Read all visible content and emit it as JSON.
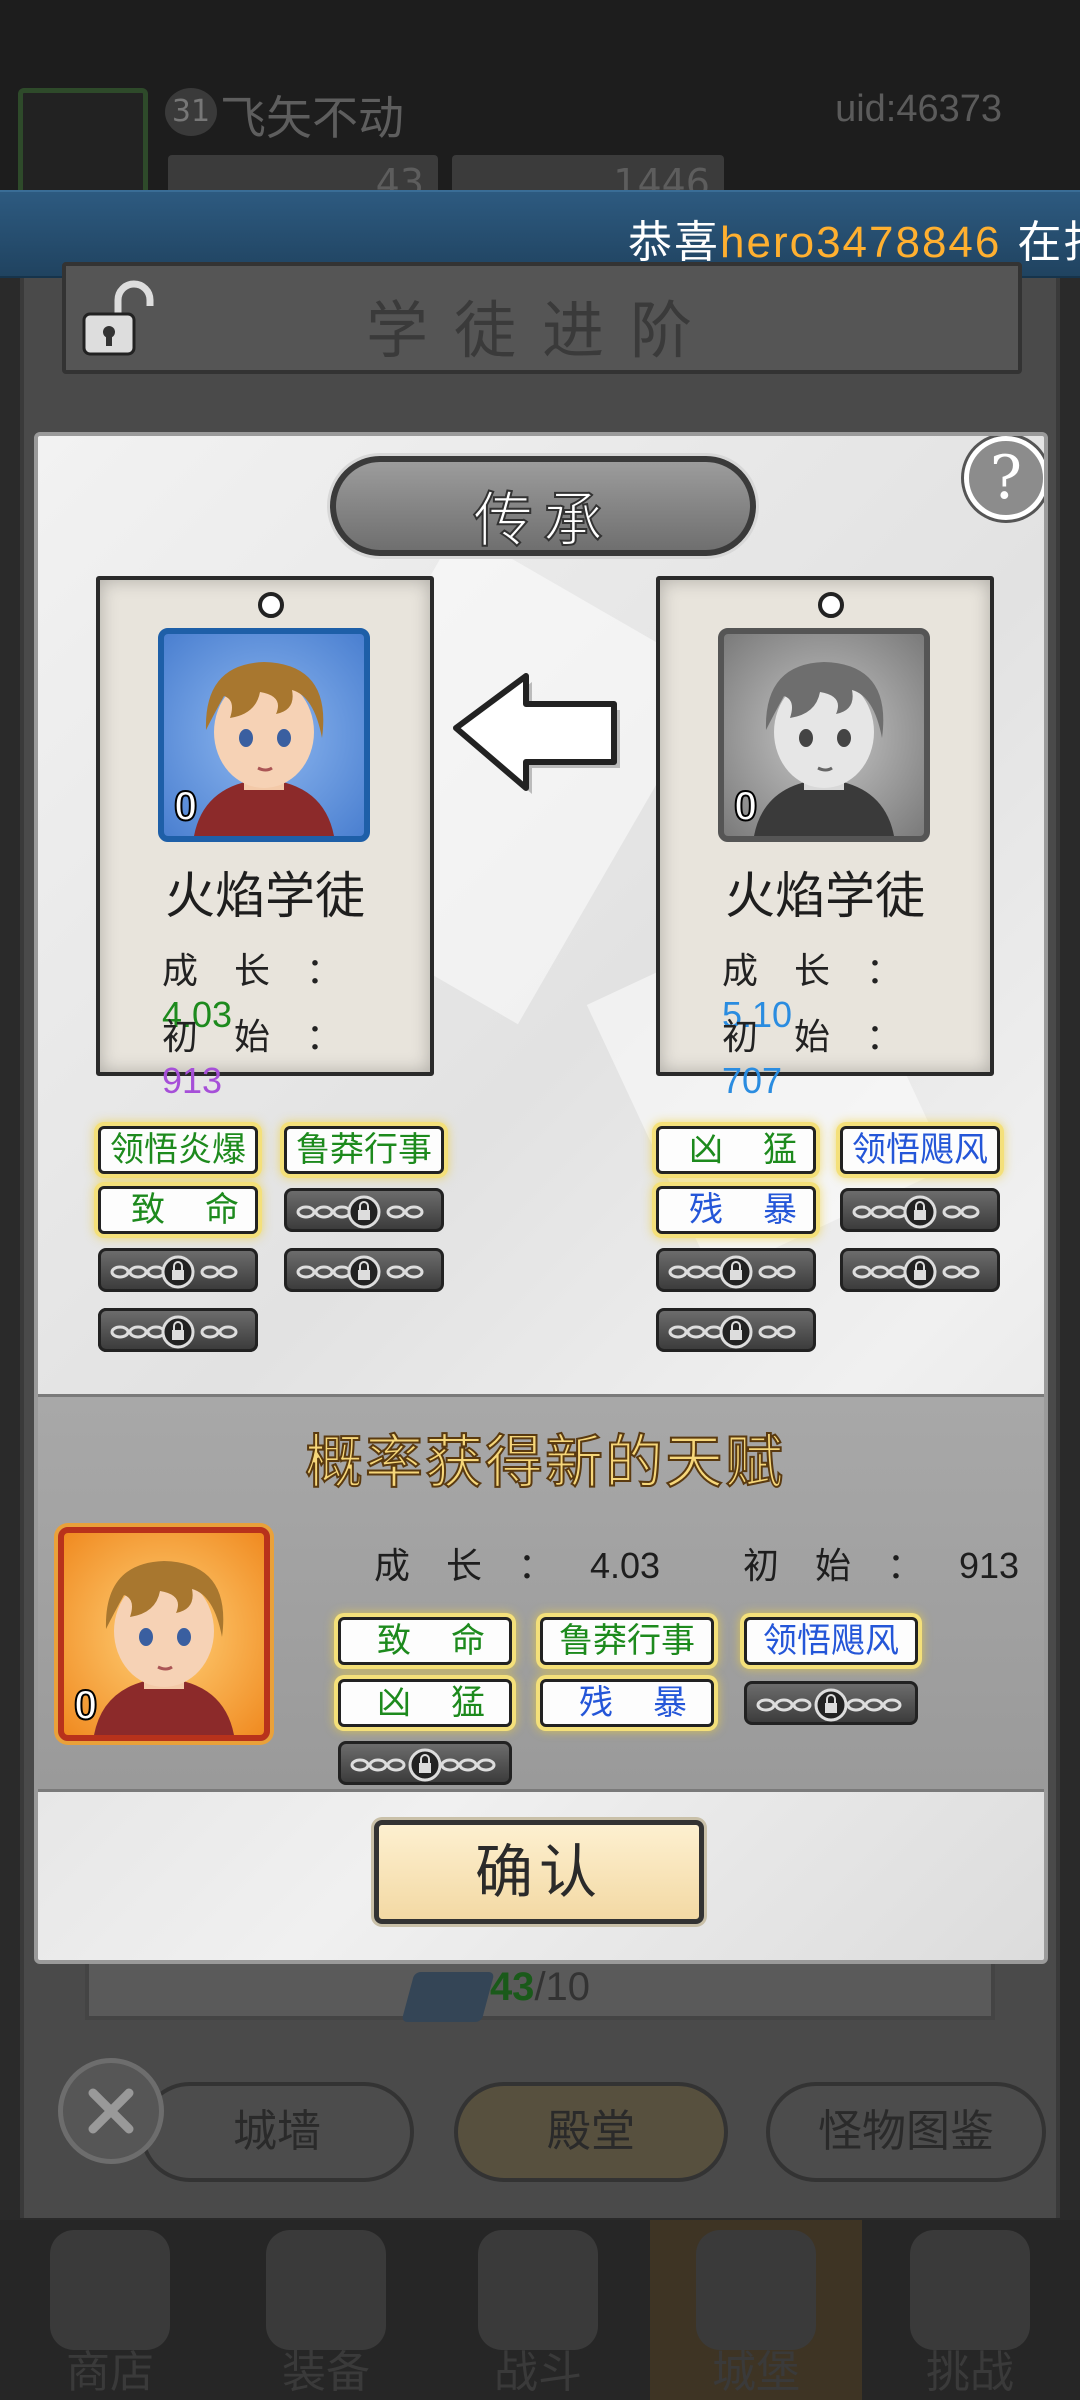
{
  "background": {
    "player": {
      "level": "31",
      "name": "飞矢不动",
      "uid": "uid:46373"
    },
    "resources": [
      {
        "value": "43"
      },
      {
        "value": "1446"
      }
    ],
    "ticker": {
      "prefix": "恭喜",
      "player": "hero3478846",
      "suffix": "在扫荡"
    },
    "panel_title": "学徒进阶",
    "card_count": {
      "current": "43",
      "total": "/10"
    },
    "tabs": [
      "城墙",
      "殿堂",
      "怪物图鉴"
    ],
    "nav": [
      "商店",
      "装备",
      "战斗",
      "城堡",
      "挑战"
    ],
    "active_nav": "城堡"
  },
  "modal": {
    "title": "传承",
    "help_label": "?",
    "left_hero": {
      "name": "火焰学徒",
      "level": "0",
      "growth_label": "成长：",
      "growth": "4.03",
      "initial_label": "初始：",
      "initial": "913",
      "growth_color": "#1d8a1d",
      "initial_color": "#a64fd8",
      "skills": [
        {
          "name": "领悟炎爆",
          "color": "green"
        },
        {
          "name": "鲁莽行事",
          "color": "green"
        },
        {
          "name": "致命",
          "color": "green"
        }
      ],
      "locked_slots": 5
    },
    "right_hero": {
      "name": "火焰学徒",
      "level": "0",
      "growth_label": "成长：",
      "growth": "5.10",
      "initial_label": "初始：",
      "initial": "707",
      "growth_color": "#2a8ce0",
      "initial_color": "#2a8ce0",
      "skills": [
        {
          "name": "凶猛",
          "color": "green"
        },
        {
          "name": "领悟飓风",
          "color": "blue"
        },
        {
          "name": "残暴",
          "color": "blue"
        }
      ],
      "locked_slots": 5
    },
    "result": {
      "title": "概率获得新的天赋",
      "level": "0",
      "growth_label": "成长：",
      "growth": "4.03",
      "initial_label": "初始：",
      "initial": "913",
      "skills": [
        {
          "name": "致命",
          "color": "green"
        },
        {
          "name": "鲁莽行事",
          "color": "green"
        },
        {
          "name": "领悟飓风",
          "color": "blue"
        },
        {
          "name": "凶猛",
          "color": "green"
        },
        {
          "name": "残暴",
          "color": "blue"
        }
      ],
      "locked_slots": 2
    },
    "confirm_label": "确认"
  }
}
